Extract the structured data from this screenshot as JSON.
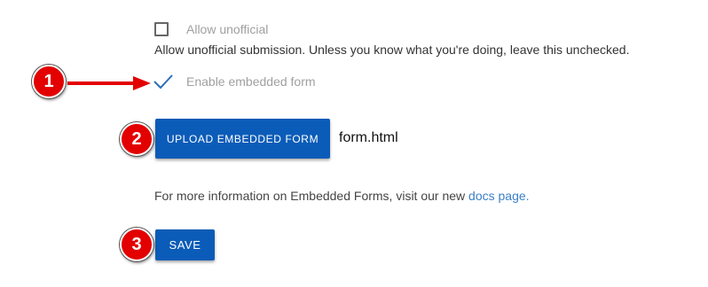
{
  "form": {
    "allow_unofficial": {
      "label": "Allow unofficial",
      "checked": false,
      "help_text": "Allow unofficial submission. Unless you know what you're doing, leave this unchecked."
    },
    "enable_embedded": {
      "label": "Enable embedded form",
      "checked": true
    },
    "upload_button_label": "UPLOAD EMBEDDED FORM",
    "uploaded_filename": "form.html",
    "info_text": "For more information on Embedded Forms, visit our new ",
    "info_link": "docs page.",
    "save_button_label": "SAVE"
  },
  "annotations": {
    "badge_1": "1",
    "badge_2": "2",
    "badge_3": "3"
  },
  "colors": {
    "primary": "#0b5cb8",
    "badge": "#e30000",
    "link": "#3a7fc8",
    "checkmark": "#2a6fb8"
  }
}
